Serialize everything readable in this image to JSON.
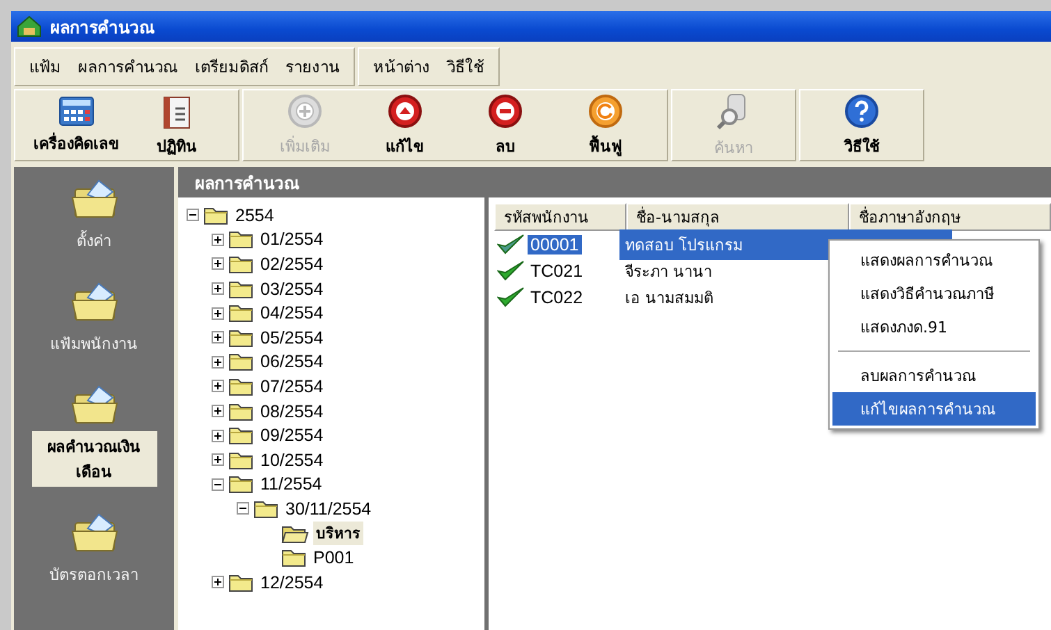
{
  "window": {
    "title": "ผลการคำนวณ"
  },
  "menu_bar": {
    "groups": [
      [
        "แฟ้ม",
        "ผลการคำนวณ",
        "เตรียมดิสก์",
        "รายงาน"
      ],
      [
        "หน้าต่าง",
        "วิธีใช้"
      ]
    ]
  },
  "toolbar": {
    "groups": [
      [
        {
          "label": "เครื่องคิดเลข",
          "kind": "calculator",
          "disabled": false
        },
        {
          "label": "ปฏิทิน",
          "kind": "calendar",
          "disabled": false
        }
      ],
      [
        {
          "label": "เพิ่มเติม",
          "kind": "add",
          "disabled": true
        },
        {
          "label": "แก้ไข",
          "kind": "edit",
          "disabled": false
        },
        {
          "label": "ลบ",
          "kind": "delete",
          "disabled": false
        },
        {
          "label": "ฟื้นฟู",
          "kind": "restore",
          "disabled": false
        }
      ],
      [
        {
          "label": "ค้นหา",
          "kind": "search",
          "disabled": true
        }
      ],
      [
        {
          "label": "วิธีใช้",
          "kind": "help",
          "disabled": false
        }
      ]
    ]
  },
  "sidebar": {
    "items": [
      {
        "label": "ตั้งค่า",
        "selected": false
      },
      {
        "label": "แฟ้มพนักงาน",
        "selected": false
      },
      {
        "label": "ผลคำนวณเงินเดือน",
        "selected": true
      },
      {
        "label": "บัตรตอกเวลา",
        "selected": false
      }
    ]
  },
  "panel": {
    "title": "ผลการคำนวณ"
  },
  "tree": [
    {
      "label": "2554",
      "expanded": true,
      "selected": false,
      "children": [
        {
          "label": "01/2554",
          "expanded": false,
          "selected": false
        },
        {
          "label": "02/2554",
          "expanded": false,
          "selected": false
        },
        {
          "label": "03/2554",
          "expanded": false,
          "selected": false
        },
        {
          "label": "04/2554",
          "expanded": false,
          "selected": false
        },
        {
          "label": "05/2554",
          "expanded": false,
          "selected": false
        },
        {
          "label": "06/2554",
          "expanded": false,
          "selected": false
        },
        {
          "label": "07/2554",
          "expanded": false,
          "selected": false
        },
        {
          "label": "08/2554",
          "expanded": false,
          "selected": false
        },
        {
          "label": "09/2554",
          "expanded": false,
          "selected": false
        },
        {
          "label": "10/2554",
          "expanded": false,
          "selected": false
        },
        {
          "label": "11/2554",
          "expanded": true,
          "selected": false,
          "children": [
            {
              "label": "30/11/2554",
              "expanded": true,
              "selected": false,
              "children": [
                {
                  "label": "บริหาร",
                  "selected": true
                },
                {
                  "label": "P001",
                  "selected": false
                }
              ]
            }
          ]
        },
        {
          "label": "12/2554",
          "expanded": false,
          "selected": false
        }
      ]
    }
  ],
  "table": {
    "columns": [
      "รหัสพนักงาน",
      "ชื่อ-นามสกุล",
      "ชื่อภาษาอังกฤษ"
    ],
    "rows": [
      {
        "code": "00001",
        "name": "ทดสอบ โปรแกรม",
        "selected": true
      },
      {
        "code": "TC021",
        "name": "จีระภา นานา",
        "selected": false
      },
      {
        "code": "TC022",
        "name": "เอ นามสมมติ",
        "selected": false
      }
    ]
  },
  "context_menu": {
    "groups": [
      [
        {
          "label": "แสดงผลการคำนวณ",
          "selected": false
        },
        {
          "label": "แสดงวิธีคำนวณภาษี",
          "selected": false
        },
        {
          "label": "แสดงภงด.91",
          "selected": false
        }
      ],
      [
        {
          "label": "ลบผลการคำนวณ",
          "selected": false
        },
        {
          "label": "แก้ไขผลการคำนวณ",
          "selected": true
        }
      ]
    ]
  }
}
